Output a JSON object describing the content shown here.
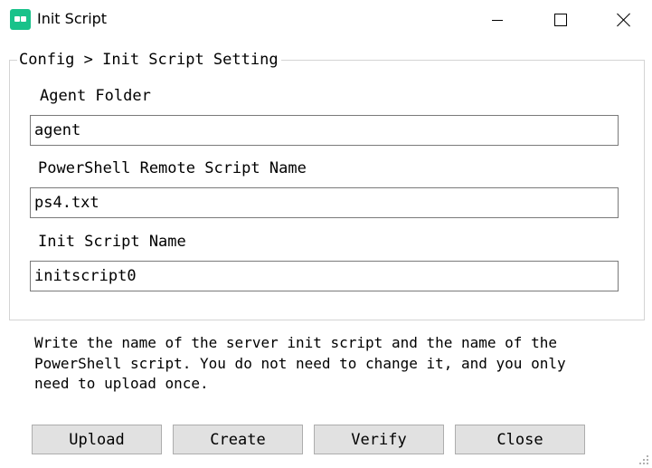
{
  "window": {
    "title": "Init Script",
    "accent_color": "#19c28a",
    "controls": [
      "minimize-icon",
      "maximize-icon",
      "close-icon"
    ]
  },
  "group": {
    "legend": "Config > Init Script Setting"
  },
  "fields": {
    "agent_folder": {
      "label": "Agent Folder",
      "value": "agent"
    },
    "ps_remote_script": {
      "label": "PowerShell Remote Script Name",
      "value": "ps4.txt"
    },
    "init_script": {
      "label": "Init Script Name",
      "value": "initscript0"
    }
  },
  "description": "Write the name of the server init script and the name of the\nPowerShell script. You do not need to change it, and you only\nneed to upload once.",
  "buttons": {
    "upload": "Upload",
    "create": "Create",
    "verify": "Verify",
    "close": "Close"
  }
}
